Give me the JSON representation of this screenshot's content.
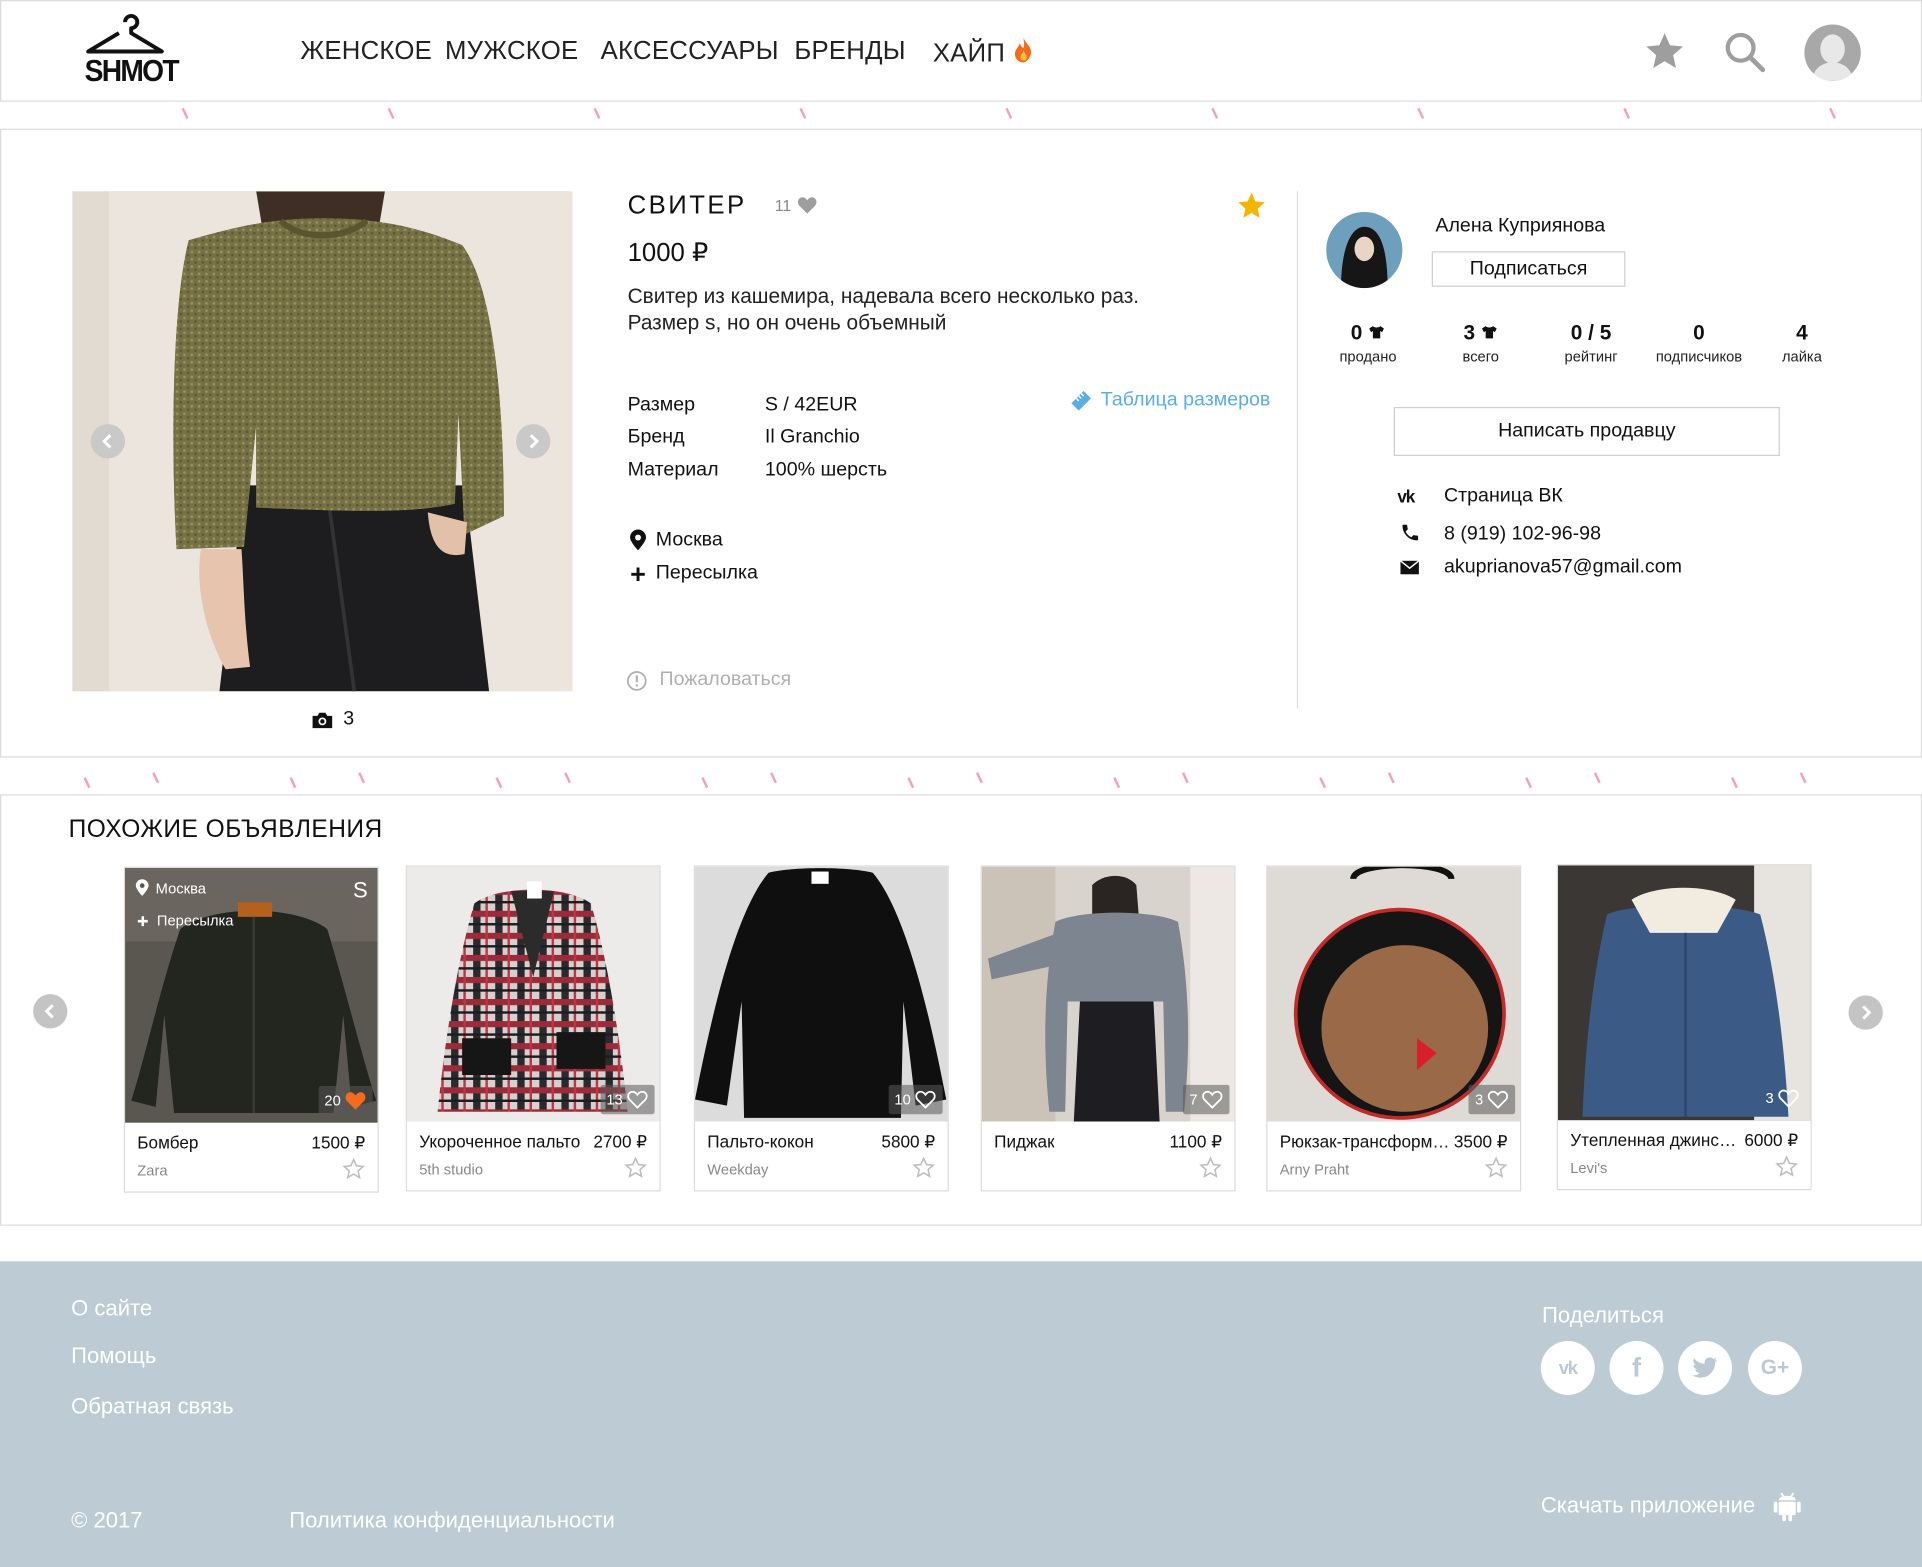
{
  "header": {
    "logo_text": "SHMOT",
    "nav": [
      "ЖЕНСКОЕ",
      "МУЖСКОЕ",
      "АКСЕССУАРЫ",
      "БРЕНДЫ",
      "ХАЙП"
    ]
  },
  "product": {
    "title": "СВИТЕР",
    "likes": "11",
    "price": "1000 ₽",
    "description_line1": "Свитер из кашемира, надевала всего несколько раз.",
    "description_line2": "Размер s, но он очень объемный",
    "size_table_link": "Таблица размеров",
    "attributes": [
      {
        "key": "Размер",
        "value": "S / 42EUR"
      },
      {
        "key": "Бренд",
        "value": "Il Granchio"
      },
      {
        "key": "Материал",
        "value": "100% шерсть"
      }
    ],
    "location": "Москва",
    "shipping": "Пересылка",
    "report": "Пожаловаться",
    "photo_count": "3",
    "colors": {
      "accent_star": "#f5b400",
      "link": "#5aaee6"
    }
  },
  "seller": {
    "name": "Алена Куприянова",
    "subscribe_label": "Подписаться",
    "stats": [
      {
        "value": "0",
        "label": "продано"
      },
      {
        "value": "3",
        "label": "всего"
      },
      {
        "value": "0 / 5",
        "label": "рейтинг"
      },
      {
        "value": "0",
        "label": "подписчиков"
      },
      {
        "value": "4",
        "label": "лайка"
      }
    ],
    "message_label": "Написать продавцу",
    "vk": "Страница ВК",
    "phone": "8 (919) 102-96-98",
    "email": "akuprianova57@gmail.com"
  },
  "similar": {
    "heading": "ПОХОЖИЕ ОБЪЯВЛЕНИЯ",
    "first_overlay": {
      "location": "Москва",
      "shipping": "Пересылка",
      "size": "S"
    },
    "items": [
      {
        "title": "Бомбер",
        "price": "1500 ₽",
        "brand": "Zara",
        "likes": "20",
        "liked": true
      },
      {
        "title": "Укороченное пальто",
        "price": "2700 ₽",
        "brand": "5th studio",
        "likes": "13",
        "liked": false
      },
      {
        "title": "Пальто-кокон",
        "price": "5800 ₽",
        "brand": "Weekday",
        "likes": "10",
        "liked": false
      },
      {
        "title": "Пиджак",
        "price": "1100 ₽",
        "brand": "",
        "likes": "7",
        "liked": false
      },
      {
        "title": "Рюкзак-трансформер",
        "price": "3500 ₽",
        "brand": "Arny Praht",
        "likes": "3",
        "liked": false
      },
      {
        "title": "Утепленная джинсовка",
        "price": "6000 ₽",
        "brand": "Levi's",
        "likes": "3",
        "liked": false
      }
    ]
  },
  "footer": {
    "links": [
      "О сайте",
      "Помощь",
      "Обратная связь"
    ],
    "share_label": "Поделиться",
    "copyright": "© 2017",
    "privacy": "Политика конфиденциальности",
    "download": "Скачать приложение",
    "bg_color": "#bccbd4"
  }
}
